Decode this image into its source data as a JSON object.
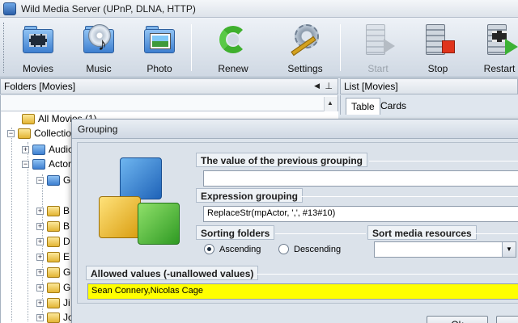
{
  "window": {
    "title": "Wild Media Server (UPnP, DLNA, HTTP)"
  },
  "toolbar": {
    "movies": "Movies",
    "music": "Music",
    "photo": "Photo",
    "renew": "Renew",
    "settings": "Settings",
    "start": "Start",
    "stop": "Stop",
    "restart": "Restart"
  },
  "left_panel": {
    "header": "Folders [Movies]",
    "tree": [
      {
        "label": "All Movies (1)"
      },
      {
        "label": "Collection"
      },
      {
        "label": "Audio"
      },
      {
        "label": "Actors"
      },
      {
        "label": "G"
      },
      {
        "label": "B"
      },
      {
        "label": "B"
      },
      {
        "label": "D"
      },
      {
        "label": "E"
      },
      {
        "label": "G"
      },
      {
        "label": "G"
      },
      {
        "label": "Ji"
      },
      {
        "label": "Jo"
      }
    ]
  },
  "right_panel": {
    "header": "List [Movies]",
    "tabs": [
      "Table",
      "Cards"
    ]
  },
  "dialog": {
    "title": "Grouping",
    "prev_group_label": "The value of the previous grouping",
    "prev_group_value": "",
    "expression_label": "Expression grouping",
    "expression_value": "ReplaceStr(mpActor, ',', #13#10)",
    "sorting_label": "Sorting folders",
    "ascending": "Ascending",
    "descending": "Descending",
    "sorting_selected": "Ascending",
    "sort_media_label": "Sort media resources",
    "sort_media_value": "",
    "allowed_label": "Allowed values (-unallowed values)",
    "allowed_value": "Sean Connery,Nicolas Cage",
    "ok_label": "Ok"
  }
}
